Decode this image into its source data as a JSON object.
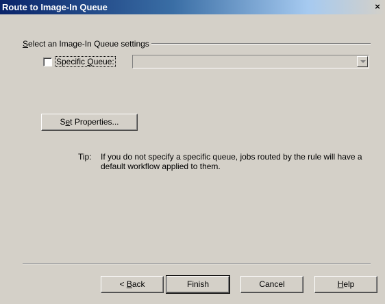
{
  "window": {
    "title": "Route to Image-In Queue",
    "close_symbol": "×"
  },
  "group": {
    "label": "Select an Image-In Queue settings"
  },
  "specific_queue": {
    "checked": false,
    "label": "Specific Queue:",
    "value": ""
  },
  "buttons": {
    "set_properties": "Set Properties...",
    "back": "< Back",
    "finish": "Finish",
    "cancel": "Cancel",
    "help": "Help"
  },
  "tip": {
    "label": "Tip:",
    "text": "If you do not specify a specific queue, jobs routed by the rule will have a default workflow applied to them."
  },
  "icons": {
    "close": "close-icon",
    "dropdown": "chevron-down-icon"
  }
}
